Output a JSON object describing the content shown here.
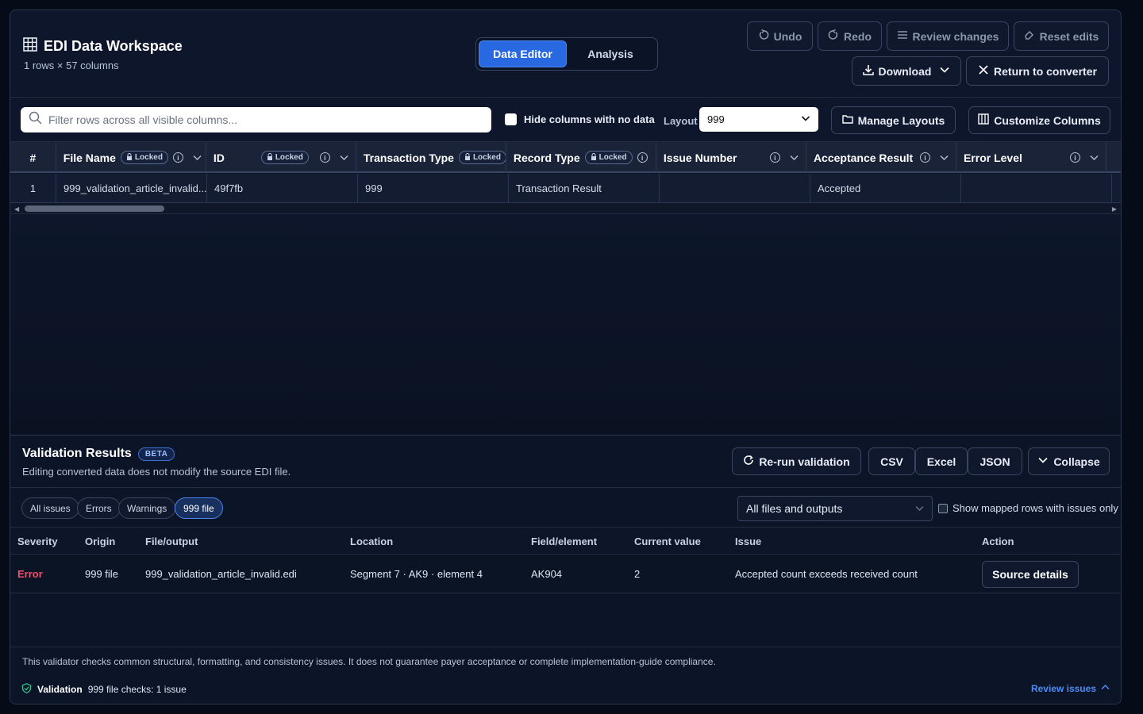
{
  "header": {
    "title": "EDI Data Workspace",
    "subtitle": "1 rows × 57 columns",
    "tabs": {
      "data_editor": "Data Editor",
      "analysis": "Analysis"
    },
    "undo": "Undo",
    "redo": "Redo",
    "review_changes": "Review changes",
    "reset_edits": "Reset edits",
    "download": "Download",
    "return": "Return to converter"
  },
  "toolbar": {
    "search_placeholder": "Filter rows across all visible columns...",
    "hide_empty": "Hide columns with no data",
    "layout_label": "Layout",
    "layout_value": "999",
    "manage_layouts": "Manage Layouts",
    "customize_columns": "Customize Columns"
  },
  "grid": {
    "locked_label": "Locked",
    "columns": {
      "num": "#",
      "file_name": "File Name",
      "id": "ID",
      "transaction_type": "Transaction Type",
      "record_type": "Record Type",
      "issue_number": "Issue Number",
      "acceptance_result": "Acceptance Result",
      "error_level": "Error Level"
    },
    "row": {
      "num": "1",
      "file_name": "999_validation_article_invalid...",
      "id": "49f7fb",
      "transaction_type": "999",
      "record_type": "Transaction Result",
      "issue_number": "",
      "acceptance_result": "Accepted",
      "error_level": ""
    }
  },
  "validation": {
    "title": "Validation Results",
    "badge": "BETA",
    "subtitle": "Editing converted data does not modify the source EDI file.",
    "rerun": "Re-run validation",
    "csv": "CSV",
    "excel": "Excel",
    "json": "JSON",
    "collapse": "Collapse",
    "filters": [
      "All issues",
      "Errors",
      "Warnings",
      "999 file"
    ],
    "active_filter": "999 file",
    "files_select": "All files and outputs",
    "mapped_only": "Show mapped rows with issues only",
    "columns": {
      "severity": "Severity",
      "origin": "Origin",
      "file": "File/output",
      "location": "Location",
      "field": "Field/element",
      "current": "Current value",
      "issue": "Issue",
      "action": "Action"
    },
    "row": {
      "severity": "Error",
      "origin": "999 file",
      "file": "999_validation_article_invalid.edi",
      "location": "Segment 7 · AK9 · element 4",
      "field": "AK904",
      "current": "2",
      "issue": "Accepted count exceeds received count",
      "action": "Source details"
    },
    "disclaimer": "This validator checks common structural, formatting, and consistency issues. It does not guarantee payer acceptance or complete implementation-guide compliance.",
    "status_label": "Validation",
    "status_text": "999 file checks: 1 issue",
    "review_issues": "Review issues"
  },
  "colors": {
    "accent": "#2868e0",
    "error": "#f0506e",
    "link": "#4d8cf5",
    "background": "#0d162a"
  },
  "icons": [
    "grid-icon",
    "undo-icon",
    "redo-icon",
    "list-icon",
    "eraser-icon",
    "download-icon",
    "close-icon",
    "search-icon",
    "folder-icon",
    "columns-icon",
    "lock-icon",
    "info-icon",
    "chevron-down-icon",
    "refresh-icon",
    "shield-check-icon",
    "chevron-up-icon"
  ]
}
